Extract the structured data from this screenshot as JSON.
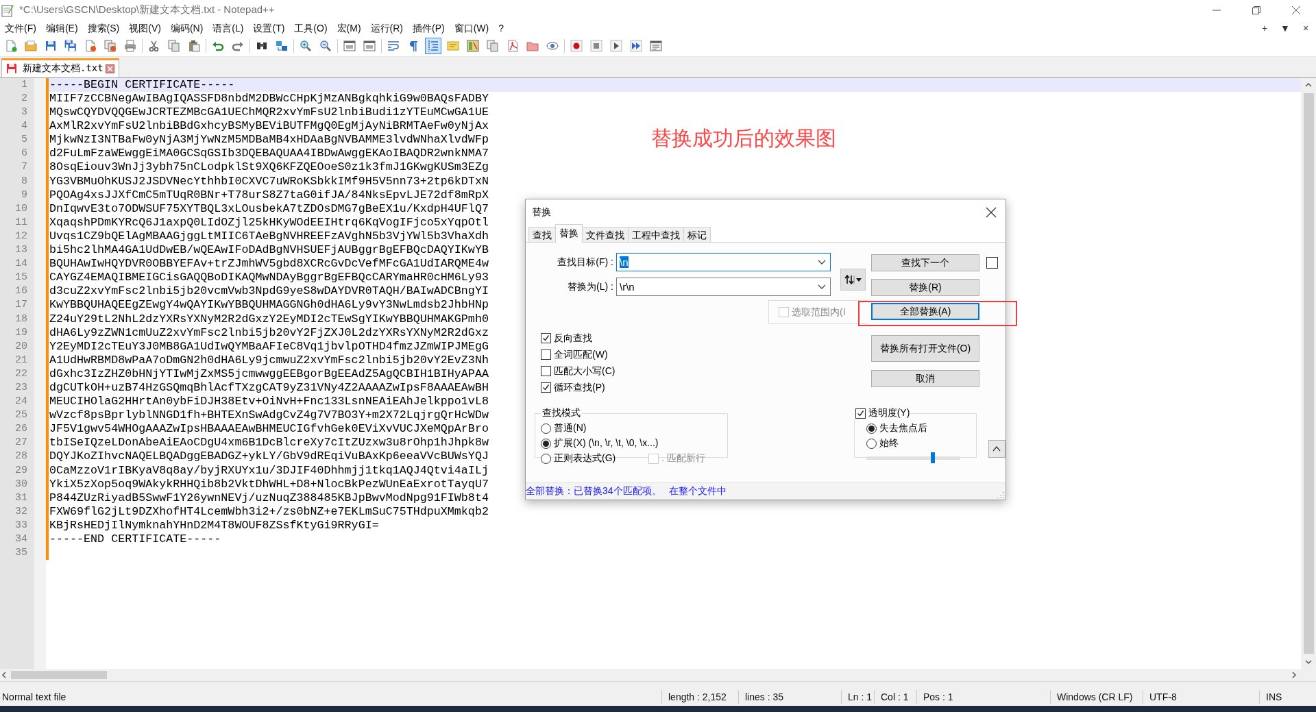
{
  "window": {
    "title": "*C:\\Users\\GSCN\\Desktop\\新建文本文档.txt - Notepad++"
  },
  "menu": [
    "文件(F)",
    "编辑(E)",
    "搜索(S)",
    "视图(V)",
    "编码(N)",
    "语言(L)",
    "设置(T)",
    "工具(O)",
    "宏(M)",
    "运行(R)",
    "插件(P)",
    "窗口(W)",
    "?"
  ],
  "menu_right": [
    "+",
    "▼",
    "×"
  ],
  "toolbar_buttons": [
    {
      "pressed": false
    },
    {
      "pressed": false
    },
    {
      "pressed": false
    },
    {
      "pressed": false
    },
    {
      "pressed": false
    },
    {
      "pressed": false
    },
    {
      "pressed": false
    },
    {
      "pressed": false
    },
    {
      "pressed": false
    },
    {
      "pressed": false
    },
    {
      "pressed": false
    },
    {
      "pressed": false
    },
    {
      "pressed": false
    },
    {
      "pressed": false
    },
    {
      "pressed": false
    },
    {
      "pressed": false
    },
    {
      "pressed": false
    },
    {
      "pressed": false
    },
    {
      "pressed": false
    },
    {
      "pressed": false
    },
    {
      "pressed": true
    },
    {
      "pressed": false
    },
    {
      "pressed": false
    },
    {
      "pressed": false
    },
    {
      "pressed": false
    },
    {
      "pressed": false
    },
    {
      "pressed": false
    },
    {
      "pressed": false
    },
    {
      "pressed": false
    },
    {
      "pressed": false
    },
    {
      "pressed": false
    },
    {
      "pressed": false
    }
  ],
  "tabs": [
    {
      "label": "新建文本文档.txt",
      "selected": true
    }
  ],
  "editor": {
    "lines": [
      {
        "number": "1",
        "text": "-----BEGIN CERTIFICATE-----",
        "current": true
      },
      {
        "number": "2",
        "text": "MIIF7zCCBNegAwIBAgIQASSFD8nbdM2DBWcCHpKjMzANBgkqhkiG9w0BAQsFADBY",
        "current": false
      },
      {
        "number": "3",
        "text": "MQswCQYDVQQGEwJCRTEZMBcGA1UEChMQR2xvYmFsU2lnbiBudi1zYTEuMCwGA1UE",
        "current": false
      },
      {
        "number": "4",
        "text": "AxMlR2xvYmFsU2lnbiBBdGxhcyBSMyBEViBUTFMgQ0EgMjAyNiBRMTAeFw0yNjAx",
        "current": false
      },
      {
        "number": "5",
        "text": "MjkwNzI3NTBaFw0yNjA3MjYwNzM5MDBaMB4xHDAaBgNVBAMME3lvdWNhaXlvdWFp",
        "current": false
      },
      {
        "number": "6",
        "text": "d2FuLmFzaWEwggEiMA0GCSqGSIb3DQEBAQUAA4IBDwAwggEKAoIBAQDR2wnkNMA7",
        "current": false
      },
      {
        "number": "7",
        "text": "8OsqEiouv3WnJj3ybh75nCLodpklSt9XQ6KFZQEOoeS0z1k3fmJ1GKwgKUSm3EZg",
        "current": false
      },
      {
        "number": "8",
        "text": "YG3VBMuOhKUSJ2JSDVNecYthhbI0CXVC7uWRoKSbkkIMf9H5V5nn73+2tp6kDTxN",
        "current": false
      },
      {
        "number": "9",
        "text": "PQOAg4xsJJXfCmC5mTUqR0BNr+T78urS8Z7taG0ifJA/84NksEpvLJE72df8mRpX",
        "current": false
      },
      {
        "number": "10",
        "text": "DnIqwvE3to7ODWSUF75XYTBQL3xLOusbekA7tZDOsDMG7gBeEX1u/KxdpH4UFlQ7",
        "current": false
      },
      {
        "number": "11",
        "text": "XqaqshPDmKYRcQ6J1axpQ0LIdOZjl25kHKyWOdEEIHtrq6KqVogIFjco5xYqpOtl",
        "current": false
      },
      {
        "number": "12",
        "text": "Uvqs1CZ9bQElAgMBAAGjggLtMIIC6TAeBgNVHREEFzAVghN5b3VjYWl5b3VhaXdh",
        "current": false
      },
      {
        "number": "13",
        "text": "bi5hc2lhMA4GA1UdDwEB/wQEAwIFoDAdBgNVHSUEFjAUBggrBgEFBQcDAQYIKwYB",
        "current": false
      },
      {
        "number": "14",
        "text": "BQUHAwIwHQYDVR0OBBYEFAv+trZJmhWV5gbd8XCRcGvDcVefMFcGA1UdIARQME4w",
        "current": false
      },
      {
        "number": "15",
        "text": "CAYGZ4EMAQIBMEIGCisGAQQBoDIKAQMwNDAyBggrBgEFBQcCARYmaHR0cHM6Ly93",
        "current": false
      },
      {
        "number": "16",
        "text": "d3cuZ2xvYmFsc2lnbi5jb20vcmVwb3NpdG9yeS8wDAYDVR0TAQH/BAIwADCBngYI",
        "current": false
      },
      {
        "number": "17",
        "text": "KwYBBQUHAQEEgZEwgY4wQAYIKwYBBQUHMAGGNGh0dHA6Ly9vY3NwLmdsb2JhbHNp",
        "current": false
      },
      {
        "number": "18",
        "text": "Z24uY29tL2NhL2dzYXRsYXNyM2R2dGxzY2EyMDI2cTEwSgYIKwYBBQUHMAKGPmh0",
        "current": false
      },
      {
        "number": "19",
        "text": "dHA6Ly9zZWN1cmUuZ2xvYmFsc2lnbi5jb20vY2FjZXJ0L2dzYXRsYXNyM2R2dGxz",
        "current": false
      },
      {
        "number": "20",
        "text": "Y2EyMDI2cTEuY3J0MB8GA1UdIwQYMBaAFIeC8Vq1jbvlpOTHD4fmzJZmWIPJMEgG",
        "current": false
      },
      {
        "number": "21",
        "text": "A1UdHwRBMD8wPaA7oDmGN2h0dHA6Ly9jcmwuZ2xvYmFsc2lnbi5jb20vY2EvZ3Nh",
        "current": false
      },
      {
        "number": "22",
        "text": "dGxhc3IzZHZ0bHNjYTIwMjZxMS5jcmwwggEEBgorBgEEAdZ5AgQCBIH1BIHyAPAA",
        "current": false
      },
      {
        "number": "23",
        "text": "dgCUTkOH+uzB74HzGSQmqBhlAcfTXzgCAT9yZ31VNy4Z2AAAAZwIpsF8AAAEAwBH",
        "current": false
      },
      {
        "number": "24",
        "text": "MEUCIHOlaG2HHrtAn0ybFiDJH38Etv+OiNvH+Fnc133LsnNEAiEAhJelkppo1vL8",
        "current": false
      },
      {
        "number": "25",
        "text": "wVzcf8psBprlyblNNGD1fh+BHTEXnSwAdgCvZ4g7V7BO3Y+m2X72LqjrgQrHcWDw",
        "current": false
      },
      {
        "number": "26",
        "text": "JF5V1gwv54WHOgAAAZwIpsHBAAAEAwBHMEUCIGfvhGek0EViXvVUCJXeMQpArBro",
        "current": false
      },
      {
        "number": "27",
        "text": "tbISeIQzeLDonAbeAiEAoCDgU4xm6B1DcBlcreXy7cItZUzxw3u8rOhp1hJhpk8w",
        "current": false
      },
      {
        "number": "28",
        "text": "DQYJKoZIhvcNAQELBQADggEBADGZ+ykLY/GbV9dREqiVuBAxKp6eeaVVcBUWsYQJ",
        "current": false
      },
      {
        "number": "29",
        "text": "0CaMzzoV1rIBKyaV8q8ay/byjRXUYx1u/3DJIF40Dhhmjj1tkq1AQJ4Qtvi4aILj",
        "current": false
      },
      {
        "number": "30",
        "text": "YkiX5zXop5oq9WAkykRHHQib8b2VktDhWHL+D8+NlocBkPezWUnEaExrotTayqU7",
        "current": false
      },
      {
        "number": "31",
        "text": "P844ZUzRiyadB5SwwF1Y26ywnNEVj/uzNuqZ388485KBJpBwvModNpg91FIWb8t4",
        "current": false
      },
      {
        "number": "32",
        "text": "FXW69flG2jLt9DZXhofHT4LcemWbh3i2+/zs0bNZ+e7EKLmSuC75THdpuXMmkqb2",
        "current": false
      },
      {
        "number": "33",
        "text": "KBjRsHEDjIlNymknahYHnD2M4T8WOUF8ZSsfKtyGi9RRyGI=",
        "current": false
      },
      {
        "number": "34",
        "text": "-----END CERTIFICATE-----",
        "current": false
      },
      {
        "number": "35",
        "current": false
      }
    ]
  },
  "annotation": {
    "text": "替换成功后的效果图"
  },
  "dialog": {
    "title": "替换",
    "tabs": [
      {
        "label": "查找",
        "selected": false
      },
      {
        "label": "替换",
        "selected": true
      },
      {
        "label": "文件查找",
        "selected": false
      },
      {
        "label": "工程中查找",
        "selected": false
      },
      {
        "label": "标记",
        "selected": false
      }
    ],
    "find": {
      "label": "查找目标(F) :",
      "value": "\\n",
      "text_selected": true
    },
    "replace": {
      "label": "替换为(L) :",
      "value": "\\r\\n",
      "text_selected": false
    },
    "in_selection": {
      "label": "选取范围内(I",
      "checked": false,
      "disabled": true
    },
    "find_next_option": {
      "checked": false
    },
    "buttons": [
      {
        "label": "查找下一个",
        "focused": false,
        "highlighted": false
      },
      {
        "label": "替换(R)",
        "focused": false,
        "highlighted": false
      },
      {
        "label": "全部替换(A)",
        "focused": true,
        "highlighted": true
      },
      {
        "label": "替换所有打开文件(O)",
        "focused": false,
        "highlighted": false
      },
      {
        "label": "取消",
        "focused": false,
        "highlighted": false
      }
    ],
    "options": [
      {
        "label": "反向查找",
        "checked": true
      },
      {
        "label": "全词匹配(W)",
        "checked": false
      },
      {
        "label": "匹配大小写(C)",
        "checked": false
      },
      {
        "label": "循环查找(P)",
        "checked": true
      }
    ],
    "search_mode": {
      "title": "查找模式",
      "modes": [
        {
          "label": "普通(N)",
          "selected": false
        },
        {
          "label": "扩展(X) (\\n, \\r, \\t, \\0, \\x...)",
          "selected": true
        },
        {
          "label": "正则表达式(G)",
          "selected": false
        }
      ],
      "dot_newline": {
        "label": ". 匹配新行",
        "checked": false,
        "disabled": true
      }
    },
    "transparency": {
      "label": "透明度(Y)",
      "checked": true,
      "modes": [
        {
          "label": "失去焦点后",
          "selected": true
        },
        {
          "label": "始终",
          "selected": false
        }
      ],
      "level": 0.71
    },
    "status": [
      "全部替换：已替换34个匹配项。",
      "在整个文件中"
    ]
  },
  "status_bar": [
    "Normal text file",
    "length : 2,152",
    "lines : 35",
    "Ln : 1",
    "Col : 1",
    "Pos : 1",
    "Windows (CR LF)",
    "UTF-8",
    "INS"
  ]
}
